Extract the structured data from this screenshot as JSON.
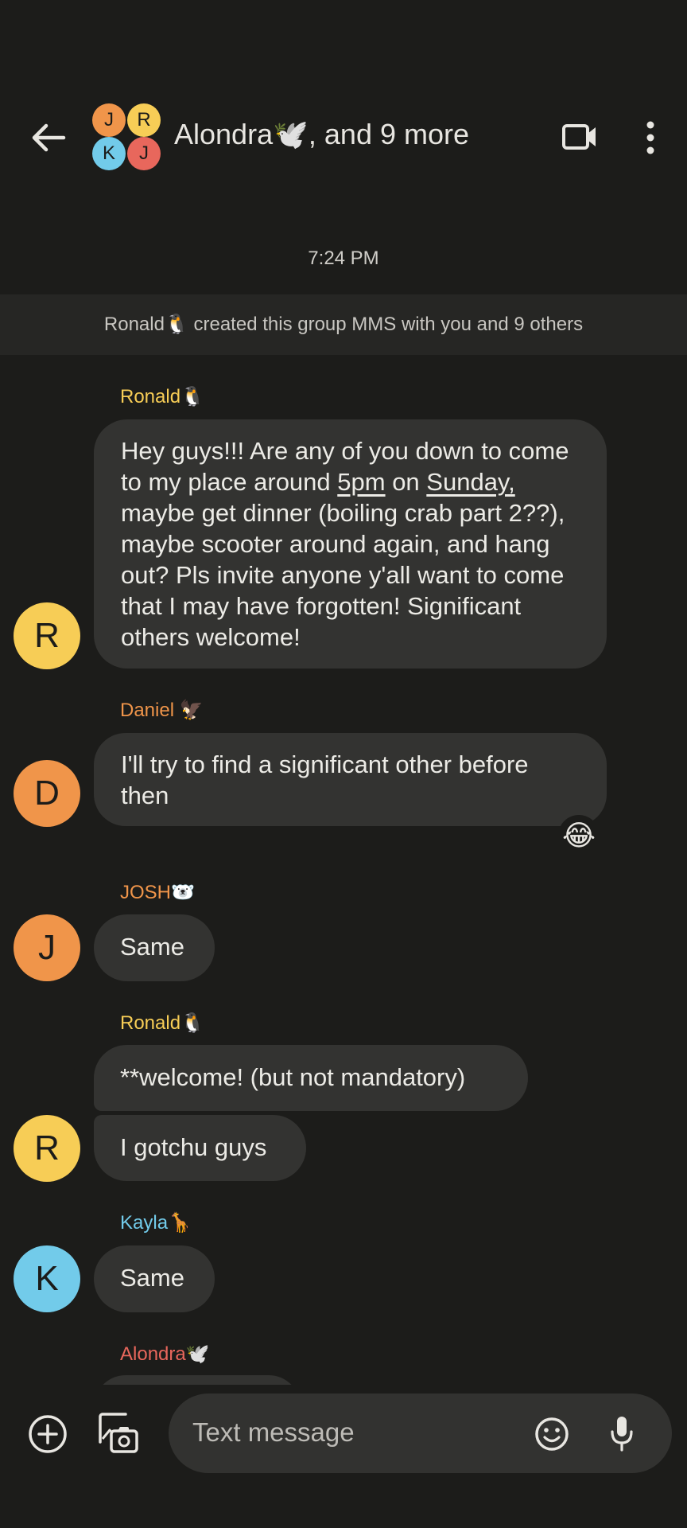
{
  "header": {
    "title": "Alondra🕊️, and 9 more",
    "group_avatar_letters": [
      "J",
      "R",
      "K",
      "J"
    ],
    "group_avatar_colors": [
      "#f0954a",
      "#f7cd56",
      "#72cbea",
      "#e8675c"
    ],
    "back_icon": "arrow-left-icon",
    "video_icon": "video-call-icon",
    "more_icon": "more-vert-icon"
  },
  "timestamp": "7:24 PM",
  "banner": "Ronald🐧 created this group MMS with you and 9 others",
  "messages": [
    {
      "sender": "Ronald🐧",
      "sender_color": "#f7cd56",
      "avatar_letter": "R",
      "avatar_color": "#f7cd56",
      "text_parts": [
        "Hey guys!!! Are any of you down to come to my place around ",
        "5pm",
        " on ",
        "Sunday,",
        " maybe get dinner (boiling crab part 2??), maybe scooter around again, and hang out? Pls invite anyone y'all want to come that I may have forgotten! Significant others welcome!"
      ]
    },
    {
      "sender": "Daniel 🦅",
      "sender_color": "#f0954a",
      "avatar_letter": "D",
      "avatar_color": "#f0954a",
      "text": "I'll try to find a significant other before then",
      "reaction": "😂"
    },
    {
      "sender": "JOSH🐻‍❄️",
      "sender_color": "#f0954a",
      "avatar_letter": "J",
      "avatar_color": "#f0954a",
      "text": "Same"
    },
    {
      "sender": "Ronald🐧",
      "sender_color": "#f7cd56",
      "avatar_letter": "R",
      "avatar_color": "#f7cd56",
      "text": "**welcome! (but not mandatory)",
      "text2": "I gotchu guys"
    },
    {
      "sender": "Kayla🦒",
      "sender_color": "#72cbea",
      "avatar_letter": "K",
      "avatar_color": "#72cbea",
      "text": "Same"
    },
    {
      "sender": "Alondra🕊️",
      "sender_color": "#e8675c"
    }
  ],
  "composer": {
    "placeholder": "Text message",
    "add_icon": "add-circle-icon",
    "gallery_icon": "gallery-camera-icon",
    "emoji_icon": "emoji-icon",
    "mic_icon": "microphone-icon"
  }
}
